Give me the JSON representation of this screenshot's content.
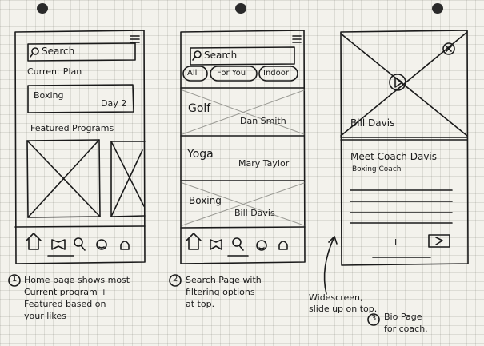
{
  "screens": [
    {
      "search_placeholder": "Search",
      "current_plan_label": "Current Plan",
      "plan_program": "Boxing",
      "plan_day": "Day 2",
      "featured_label": "Featured Programs",
      "caption_number": "1",
      "caption": [
        "Home page shows most",
        "Current program +",
        "Featured based on",
        "your likes"
      ]
    },
    {
      "search_placeholder": "Search",
      "filters": [
        "All",
        "For You",
        "Indoor"
      ],
      "results": [
        {
          "sport": "Golf",
          "coach": "Dan Smith"
        },
        {
          "sport": "Yoga",
          "coach": "Mary Taylor"
        },
        {
          "sport": "Boxing",
          "coach": "Bill Davis"
        }
      ],
      "caption_number": "2",
      "caption": [
        "Search Page with",
        "filtering options",
        "at top."
      ]
    },
    {
      "hero_name": "Bill Davis",
      "bio_title": "Meet Coach Davis",
      "bio_subtitle": "Boxing Coach",
      "pager_left": "I",
      "side_note": [
        "Widescreen,",
        "slide up on top."
      ],
      "caption_number": "3",
      "caption": [
        "Bio Page",
        "for coach."
      ]
    }
  ],
  "nav_icons": [
    "home-icon",
    "book-icon",
    "search-icon",
    "coach-icon",
    "profile-icon"
  ]
}
